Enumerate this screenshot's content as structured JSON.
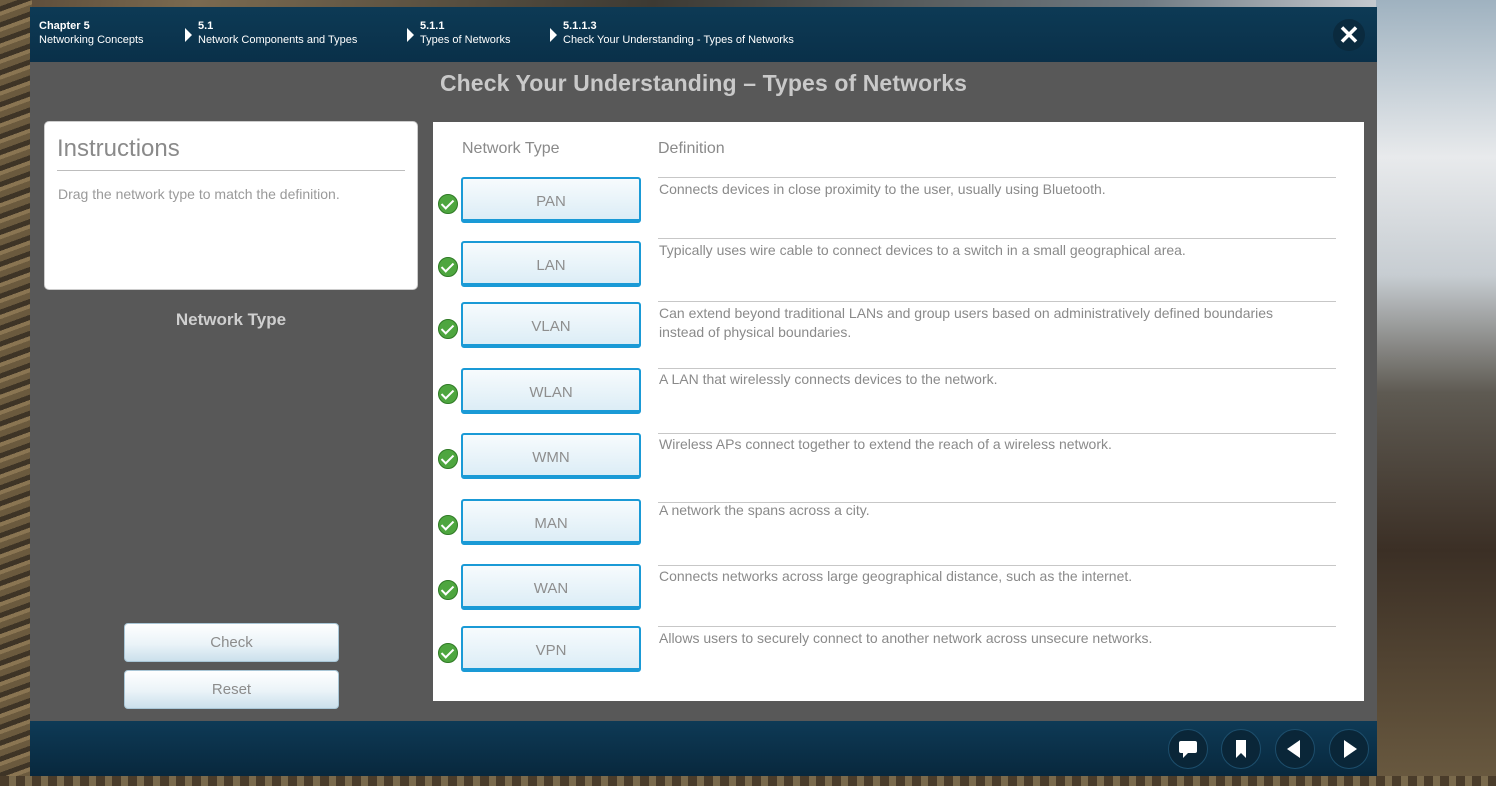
{
  "breadcrumb": [
    {
      "num": "Chapter 5",
      "label": "Networking Concepts"
    },
    {
      "num": "5.1",
      "label": "Network Components and Types"
    },
    {
      "num": "5.1.1",
      "label": "Types of Networks"
    },
    {
      "num": "5.1.1.3",
      "label": "Check Your Understanding - Types of Networks"
    }
  ],
  "close_icon": "close-icon",
  "page_title": "Check Your Understanding – Types of Networks",
  "instructions": {
    "title": "Instructions",
    "text": "Drag the network type to match the definition."
  },
  "side_heading": "Network Type",
  "buttons": {
    "check": "Check",
    "reset": "Reset"
  },
  "columns": {
    "type": "Network Type",
    "definition": "Definition"
  },
  "rows": [
    {
      "type": "PAN",
      "definition": "Connects devices in close proximity to the user, usually using Bluetooth.",
      "correct": true
    },
    {
      "type": "LAN",
      "definition": "Typically uses wire cable to connect devices to a switch in a small geographical area.",
      "correct": true
    },
    {
      "type": "VLAN",
      "definition": "Can extend beyond traditional LANs and group users based on administratively defined boundaries instead of physical boundaries.",
      "correct": true
    },
    {
      "type": "WLAN",
      "definition": "A LAN that wirelessly connects devices to the network.",
      "correct": true
    },
    {
      "type": "WMN",
      "definition": "Wireless APs connect together to extend the reach of a wireless network.",
      "correct": true
    },
    {
      "type": "MAN",
      "definition": "A network the spans across a city.",
      "correct": true
    },
    {
      "type": "WAN",
      "definition": "Connects networks across large geographical distance, such as the internet.",
      "correct": true
    },
    {
      "type": "VPN",
      "definition": "Allows users to securely connect to another network across unsecure networks.",
      "correct": true
    }
  ],
  "footer_icons": [
    "comment-icon",
    "bookmark-icon",
    "previous-icon",
    "next-icon"
  ],
  "colors": {
    "topbar": "#0d3a55",
    "tile_border": "#1a9ad6",
    "check_green": "#4ea63f"
  }
}
